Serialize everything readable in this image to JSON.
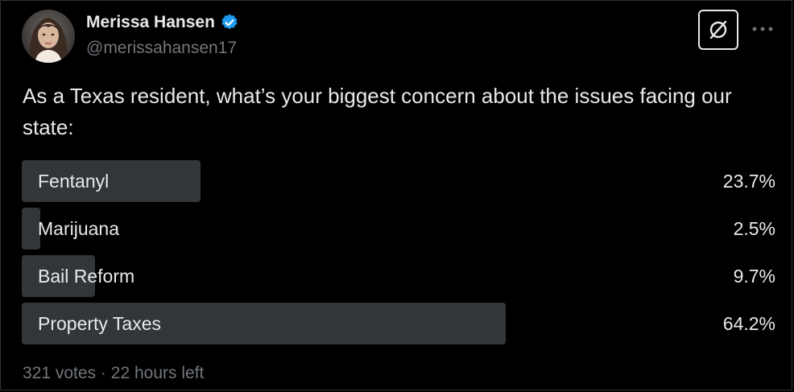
{
  "author": {
    "name": "Merissa Hansen",
    "handle": "@merissahansen17",
    "verified": true,
    "verified_icon": "verified-badge-icon",
    "accent_color": "#1d9bf0"
  },
  "actions": {
    "grok_icon": "grok-icon",
    "more_icon": "more-horizontal-icon"
  },
  "post": {
    "text": "As a Texas resident, what’s your biggest concern about the issues facing our state:"
  },
  "poll": {
    "options": [
      {
        "label": "Fentanyl",
        "percent_text": "23.7%",
        "value": 23.7
      },
      {
        "label": "Marijuana",
        "percent_text": "2.5%",
        "value": 2.5
      },
      {
        "label": "Bail Reform",
        "percent_text": "9.7%",
        "value": 9.7
      },
      {
        "label": "Property Taxes",
        "percent_text": "64.2%",
        "value": 64.2
      }
    ],
    "votes_text": "321 votes",
    "separator": "·",
    "time_left_text": "22 hours left",
    "bar_color": "#333639"
  }
}
